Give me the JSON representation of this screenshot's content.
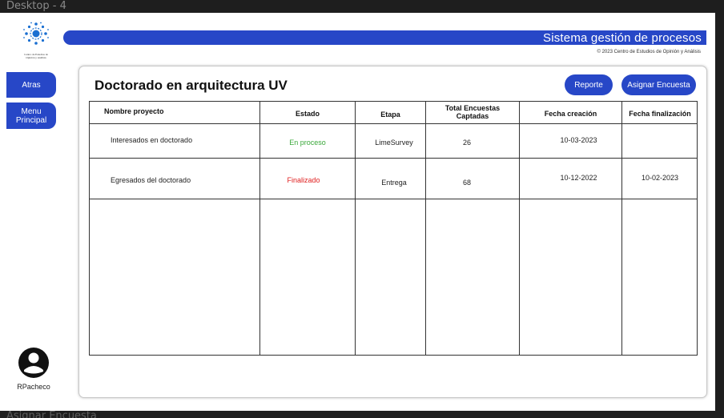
{
  "frame": {
    "label": "Desktop - 4",
    "next_label": "Asignar Encuesta"
  },
  "header": {
    "title": "Sistema gestión de procesos",
    "copyright": "© 2023 Centro de Estudios de Opinión y Análisis"
  },
  "logo": {
    "text_line1": "Centro de Estudios de",
    "text_line2": "Opinión y Análisis"
  },
  "sidebar": {
    "back_label": "Atras",
    "menu_label": "Menu Principal"
  },
  "user": {
    "name": "RPacheco"
  },
  "page": {
    "title": "Doctorado en arquitectura UV"
  },
  "actions": {
    "report_label": "Reporte",
    "assign_label": "Asignar Encuesta"
  },
  "table": {
    "columns": [
      "Nombre proyecto",
      "Estado",
      "Etapa",
      "Total Encuestas Captadas",
      "Fecha creación",
      "Fecha finalización"
    ],
    "rows": [
      {
        "nombre": "Interesados en doctorado",
        "estado": "En proceso",
        "etapa": "LimeSurvey",
        "total": "26",
        "creacion": "10-03-2023",
        "finalizacion": ""
      },
      {
        "nombre": "Egresados del doctorado",
        "estado": "Finalizado",
        "etapa": "Entrega",
        "total": "68",
        "creacion": "10-12-2022",
        "finalizacion": "10-02-2023"
      }
    ]
  },
  "colors": {
    "accent": "#2747c7",
    "in_progress": "#3aa83a",
    "finished": "#e02020"
  }
}
